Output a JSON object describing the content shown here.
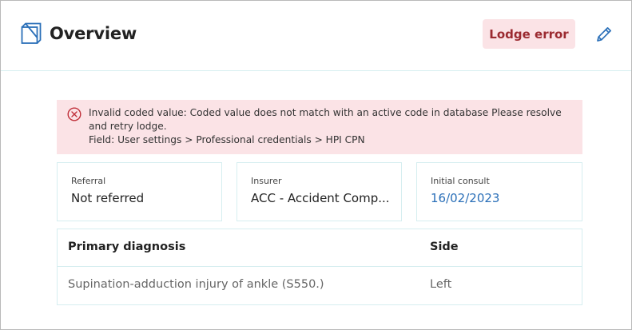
{
  "header": {
    "title": "Overview",
    "lodge_button": "Lodge error",
    "icons": {
      "page": "document-icon",
      "edit": "pencil-icon"
    }
  },
  "alert": {
    "icon": "error-circle-x-icon",
    "line1": "Invalid coded value: Coded value does not match with an active code in database Please resolve",
    "line2": "and retry lodge.",
    "line3": "Field: User settings > Professional credentials > HPI CPN",
    "colors": {
      "background": "#fbe3e6",
      "icon": "#c0303a"
    }
  },
  "cards": [
    {
      "label": "Referral",
      "value": "Not referred"
    },
    {
      "label": "Insurer",
      "value": "ACC - Accident Comp..."
    },
    {
      "label": "Initial consult",
      "value": "16/02/2023"
    }
  ],
  "table": {
    "headers": [
      "Primary diagnosis",
      "Side"
    ],
    "rows": [
      [
        "Supination-adduction injury of ankle (S550.)",
        "Left"
      ]
    ]
  },
  "colors": {
    "accent": "#2a6fb8",
    "error_text": "#9b2a30",
    "border": "#d6eef0"
  }
}
